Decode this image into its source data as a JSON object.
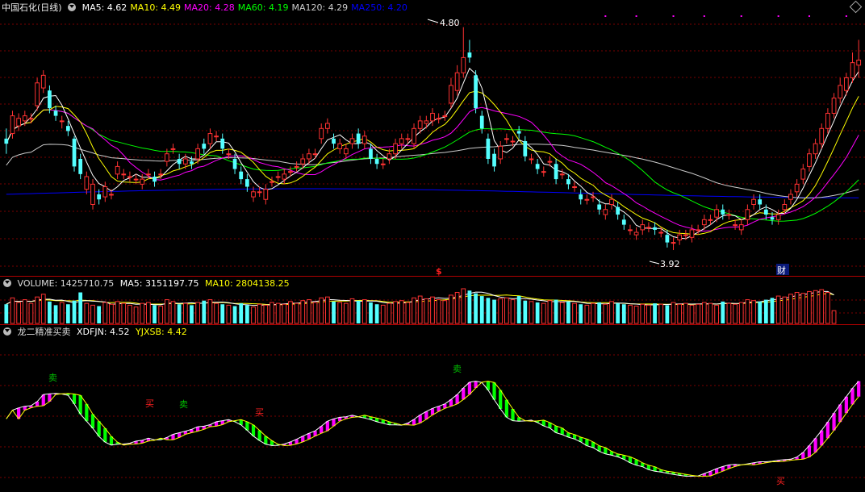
{
  "main_header": {
    "title": "中国石化(日线)",
    "indicators": [
      {
        "label": "MA5: 4.62",
        "color": "#ffffff"
      },
      {
        "label": "MA10: 4.49",
        "color": "#ffff00"
      },
      {
        "label": "MA20: 4.28",
        "color": "#ff00ff"
      },
      {
        "label": "MA60: 4.19",
        "color": "#00ff00"
      },
      {
        "label": "MA120: 4.29",
        "color": "#cccccc"
      },
      {
        "label": "MA250: 4.20",
        "color": "#0000ff"
      }
    ]
  },
  "volume_header": {
    "title": "VOLUME: 1425710.75",
    "ma5": "MA5: 3151197.75",
    "ma10": "MA10: 2804138.25"
  },
  "indicator_header": {
    "title": "龙二精准买卖",
    "xdfjn": "XDFJN: 4.52",
    "yjxsb": "YJXSB: 4.42"
  },
  "annotations": {
    "high_label": "4.80",
    "low_label": "3.92",
    "dollar_marker": "$",
    "finance_marker": "财",
    "buy_label": "买",
    "sell_label": "卖"
  },
  "colors": {
    "up": "#ff3232",
    "down": "#54ffff",
    "grid": "#7a0000",
    "separator": "#b00000",
    "ma5": "#ffffff",
    "ma10": "#ffff00",
    "ma20": "#ff00ff",
    "ma60": "#00ff00",
    "ma120": "#cccccc",
    "ma250": "#0000ff",
    "ind_up": "#ff00ff",
    "ind_down": "#00ff00"
  },
  "chart_data": {
    "type": "candlestick",
    "symbol": "中国石化",
    "period": "日线",
    "price_range": [
      3.85,
      4.85
    ],
    "price_high": 4.8,
    "price_low": 3.92,
    "candles": [
      {
        "o": 4.36,
        "c": 4.34,
        "h": 4.4,
        "l": 4.3
      },
      {
        "o": 4.38,
        "c": 4.45,
        "h": 4.47,
        "l": 4.36
      },
      {
        "o": 4.41,
        "c": 4.44,
        "h": 4.46,
        "l": 4.39
      },
      {
        "o": 4.43,
        "c": 4.45,
        "h": 4.47,
        "l": 4.41
      },
      {
        "o": 4.44,
        "c": 4.44,
        "h": 4.46,
        "l": 4.42
      },
      {
        "o": 4.49,
        "c": 4.58,
        "h": 4.6,
        "l": 4.47
      },
      {
        "o": 4.56,
        "c": 4.61,
        "h": 4.63,
        "l": 4.54
      },
      {
        "o": 4.55,
        "c": 4.48,
        "h": 4.57,
        "l": 4.46
      },
      {
        "o": 4.47,
        "c": 4.45,
        "h": 4.49,
        "l": 4.43
      },
      {
        "o": 4.43,
        "c": 4.43,
        "h": 4.45,
        "l": 4.4
      },
      {
        "o": 4.41,
        "c": 4.39,
        "h": 4.43,
        "l": 4.37
      },
      {
        "o": 4.36,
        "c": 4.25,
        "h": 4.37,
        "l": 4.23
      },
      {
        "o": 4.28,
        "c": 4.22,
        "h": 4.3,
        "l": 4.2
      },
      {
        "o": 4.16,
        "c": 4.21,
        "h": 4.23,
        "l": 4.14
      },
      {
        "o": 4.1,
        "c": 4.18,
        "h": 4.2,
        "l": 4.08
      },
      {
        "o": 4.14,
        "c": 4.12,
        "h": 4.16,
        "l": 4.1
      },
      {
        "o": 4.13,
        "c": 4.17,
        "h": 4.19,
        "l": 4.11
      },
      {
        "o": 4.14,
        "c": 4.14,
        "h": 4.16,
        "l": 4.12
      },
      {
        "o": 4.22,
        "c": 4.25,
        "h": 4.27,
        "l": 4.2
      },
      {
        "o": 4.22,
        "c": 4.22,
        "h": 4.24,
        "l": 4.2
      },
      {
        "o": 4.21,
        "c": 4.21,
        "h": 4.23,
        "l": 4.19
      },
      {
        "o": 4.2,
        "c": 4.2,
        "h": 4.22,
        "l": 4.18
      },
      {
        "o": 4.18,
        "c": 4.2,
        "h": 4.22,
        "l": 4.16
      },
      {
        "o": 4.22,
        "c": 4.22,
        "h": 4.24,
        "l": 4.2
      },
      {
        "o": 4.21,
        "c": 4.19,
        "h": 4.23,
        "l": 4.17
      },
      {
        "o": 4.22,
        "c": 4.22,
        "h": 4.24,
        "l": 4.2
      },
      {
        "o": 4.27,
        "c": 4.3,
        "h": 4.32,
        "l": 4.25
      },
      {
        "o": 4.32,
        "c": 4.32,
        "h": 4.34,
        "l": 4.3
      },
      {
        "o": 4.28,
        "c": 4.26,
        "h": 4.3,
        "l": 4.24
      },
      {
        "o": 4.26,
        "c": 4.28,
        "h": 4.3,
        "l": 4.24
      },
      {
        "o": 4.27,
        "c": 4.26,
        "h": 4.29,
        "l": 4.24
      },
      {
        "o": 4.28,
        "c": 4.32,
        "h": 4.34,
        "l": 4.26
      },
      {
        "o": 4.34,
        "c": 4.32,
        "h": 4.36,
        "l": 4.3
      },
      {
        "o": 4.34,
        "c": 4.38,
        "h": 4.4,
        "l": 4.32
      },
      {
        "o": 4.37,
        "c": 4.37,
        "h": 4.39,
        "l": 4.35
      },
      {
        "o": 4.36,
        "c": 4.32,
        "h": 4.38,
        "l": 4.3
      },
      {
        "o": 4.3,
        "c": 4.3,
        "h": 4.32,
        "l": 4.28
      },
      {
        "o": 4.28,
        "c": 4.24,
        "h": 4.3,
        "l": 4.22
      },
      {
        "o": 4.23,
        "c": 4.2,
        "h": 4.25,
        "l": 4.18
      },
      {
        "o": 4.2,
        "c": 4.17,
        "h": 4.22,
        "l": 4.15
      },
      {
        "o": 4.13,
        "c": 4.15,
        "h": 4.17,
        "l": 4.11
      },
      {
        "o": 4.15,
        "c": 4.15,
        "h": 4.17,
        "l": 4.13
      },
      {
        "o": 4.12,
        "c": 4.16,
        "h": 4.18,
        "l": 4.1
      },
      {
        "o": 4.19,
        "c": 4.19,
        "h": 4.21,
        "l": 4.17
      },
      {
        "o": 4.21,
        "c": 4.21,
        "h": 4.23,
        "l": 4.19
      },
      {
        "o": 4.2,
        "c": 4.22,
        "h": 4.24,
        "l": 4.18
      },
      {
        "o": 4.23,
        "c": 4.23,
        "h": 4.25,
        "l": 4.21
      },
      {
        "o": 4.25,
        "c": 4.25,
        "h": 4.27,
        "l": 4.23
      },
      {
        "o": 4.26,
        "c": 4.28,
        "h": 4.3,
        "l": 4.24
      },
      {
        "o": 4.28,
        "c": 4.3,
        "h": 4.32,
        "l": 4.26
      },
      {
        "o": 4.3,
        "c": 4.3,
        "h": 4.32,
        "l": 4.28
      },
      {
        "o": 4.36,
        "c": 4.4,
        "h": 4.42,
        "l": 4.34
      },
      {
        "o": 4.4,
        "c": 4.42,
        "h": 4.44,
        "l": 4.38
      },
      {
        "o": 4.36,
        "c": 4.34,
        "h": 4.38,
        "l": 4.32
      },
      {
        "o": 4.32,
        "c": 4.34,
        "h": 4.36,
        "l": 4.3
      },
      {
        "o": 4.3,
        "c": 4.32,
        "h": 4.34,
        "l": 4.28
      },
      {
        "o": 4.34,
        "c": 4.36,
        "h": 4.38,
        "l": 4.32
      },
      {
        "o": 4.38,
        "c": 4.34,
        "h": 4.4,
        "l": 4.32
      },
      {
        "o": 4.34,
        "c": 4.37,
        "h": 4.39,
        "l": 4.32
      },
      {
        "o": 4.32,
        "c": 4.28,
        "h": 4.34,
        "l": 4.26
      },
      {
        "o": 4.28,
        "c": 4.26,
        "h": 4.3,
        "l": 4.24
      },
      {
        "o": 4.26,
        "c": 4.26,
        "h": 4.28,
        "l": 4.24
      },
      {
        "o": 4.28,
        "c": 4.3,
        "h": 4.32,
        "l": 4.26
      },
      {
        "o": 4.3,
        "c": 4.34,
        "h": 4.36,
        "l": 4.28
      },
      {
        "o": 4.34,
        "c": 4.36,
        "h": 4.38,
        "l": 4.32
      },
      {
        "o": 4.36,
        "c": 4.36,
        "h": 4.38,
        "l": 4.34
      },
      {
        "o": 4.34,
        "c": 4.4,
        "h": 4.42,
        "l": 4.32
      },
      {
        "o": 4.4,
        "c": 4.43,
        "h": 4.45,
        "l": 4.38
      },
      {
        "o": 4.42,
        "c": 4.43,
        "h": 4.45,
        "l": 4.4
      },
      {
        "o": 4.43,
        "c": 4.46,
        "h": 4.48,
        "l": 4.41
      },
      {
        "o": 4.44,
        "c": 4.44,
        "h": 4.46,
        "l": 4.42
      },
      {
        "o": 4.45,
        "c": 4.45,
        "h": 4.47,
        "l": 4.43
      },
      {
        "o": 4.5,
        "c": 4.57,
        "h": 4.6,
        "l": 4.48
      },
      {
        "o": 4.55,
        "c": 4.62,
        "h": 4.65,
        "l": 4.53
      },
      {
        "o": 4.62,
        "c": 4.68,
        "h": 4.8,
        "l": 4.6
      },
      {
        "o": 4.7,
        "c": 4.68,
        "h": 4.75,
        "l": 4.66
      },
      {
        "o": 4.61,
        "c": 4.48,
        "h": 4.63,
        "l": 4.46
      },
      {
        "o": 4.45,
        "c": 4.4,
        "h": 4.47,
        "l": 4.38
      },
      {
        "o": 4.36,
        "c": 4.28,
        "h": 4.38,
        "l": 4.26
      },
      {
        "o": 4.3,
        "c": 4.25,
        "h": 4.32,
        "l": 4.23
      },
      {
        "o": 4.28,
        "c": 4.33,
        "h": 4.35,
        "l": 4.26
      },
      {
        "o": 4.36,
        "c": 4.36,
        "h": 4.38,
        "l": 4.34
      },
      {
        "o": 4.35,
        "c": 4.35,
        "h": 4.37,
        "l": 4.33
      },
      {
        "o": 4.39,
        "c": 4.38,
        "h": 4.41,
        "l": 4.36
      },
      {
        "o": 4.35,
        "c": 4.29,
        "h": 4.37,
        "l": 4.27
      },
      {
        "o": 4.28,
        "c": 4.28,
        "h": 4.3,
        "l": 4.26
      },
      {
        "o": 4.26,
        "c": 4.24,
        "h": 4.28,
        "l": 4.22
      },
      {
        "o": 4.23,
        "c": 4.23,
        "h": 4.25,
        "l": 4.21
      },
      {
        "o": 4.27,
        "c": 4.27,
        "h": 4.29,
        "l": 4.25
      },
      {
        "o": 4.26,
        "c": 4.2,
        "h": 4.28,
        "l": 4.18
      },
      {
        "o": 4.22,
        "c": 4.22,
        "h": 4.24,
        "l": 4.2
      },
      {
        "o": 4.2,
        "c": 4.18,
        "h": 4.22,
        "l": 4.16
      },
      {
        "o": 4.17,
        "c": 4.17,
        "h": 4.19,
        "l": 4.15
      },
      {
        "o": 4.14,
        "c": 4.12,
        "h": 4.16,
        "l": 4.1
      },
      {
        "o": 4.12,
        "c": 4.12,
        "h": 4.14,
        "l": 4.1
      },
      {
        "o": 4.13,
        "c": 4.13,
        "h": 4.15,
        "l": 4.11
      },
      {
        "o": 4.1,
        "c": 4.08,
        "h": 4.12,
        "l": 4.06
      },
      {
        "o": 4.06,
        "c": 4.08,
        "h": 4.1,
        "l": 4.04
      },
      {
        "o": 4.1,
        "c": 4.12,
        "h": 4.14,
        "l": 4.08
      },
      {
        "o": 4.09,
        "c": 4.06,
        "h": 4.11,
        "l": 4.04
      },
      {
        "o": 4.04,
        "c": 4.02,
        "h": 4.06,
        "l": 4.0
      },
      {
        "o": 4.0,
        "c": 4.0,
        "h": 4.02,
        "l": 3.98
      },
      {
        "o": 3.98,
        "c": 3.99,
        "h": 4.01,
        "l": 3.96
      },
      {
        "o": 4.0,
        "c": 4.02,
        "h": 4.04,
        "l": 3.98
      },
      {
        "o": 4.01,
        "c": 4.01,
        "h": 4.03,
        "l": 3.99
      },
      {
        "o": 4.01,
        "c": 4.0,
        "h": 4.03,
        "l": 3.98
      },
      {
        "o": 3.99,
        "c": 3.99,
        "h": 4.01,
        "l": 3.97
      },
      {
        "o": 3.98,
        "c": 3.95,
        "h": 4.0,
        "l": 3.93
      },
      {
        "o": 3.95,
        "c": 3.95,
        "h": 3.97,
        "l": 3.92
      },
      {
        "o": 3.96,
        "c": 3.98,
        "h": 4.0,
        "l": 3.94
      },
      {
        "o": 3.98,
        "c": 3.98,
        "h": 4.0,
        "l": 3.96
      },
      {
        "o": 3.97,
        "c": 4.0,
        "h": 4.02,
        "l": 3.95
      },
      {
        "o": 4.0,
        "c": 4.0,
        "h": 4.02,
        "l": 3.98
      },
      {
        "o": 4.02,
        "c": 4.04,
        "h": 4.06,
        "l": 4.0
      },
      {
        "o": 4.04,
        "c": 4.04,
        "h": 4.06,
        "l": 4.02
      },
      {
        "o": 4.05,
        "c": 4.08,
        "h": 4.1,
        "l": 4.03
      },
      {
        "o": 4.08,
        "c": 4.06,
        "h": 4.1,
        "l": 4.04
      },
      {
        "o": 4.06,
        "c": 4.06,
        "h": 4.08,
        "l": 4.04
      },
      {
        "o": 4.02,
        "c": 4.02,
        "h": 4.04,
        "l": 4.0
      },
      {
        "o": 4.0,
        "c": 4.02,
        "h": 4.04,
        "l": 3.98
      },
      {
        "o": 4.04,
        "c": 4.08,
        "h": 4.1,
        "l": 4.02
      },
      {
        "o": 4.1,
        "c": 4.12,
        "h": 4.14,
        "l": 4.08
      },
      {
        "o": 4.12,
        "c": 4.1,
        "h": 4.14,
        "l": 4.08
      },
      {
        "o": 4.08,
        "c": 4.06,
        "h": 4.1,
        "l": 4.04
      },
      {
        "o": 4.05,
        "c": 4.04,
        "h": 4.07,
        "l": 4.02
      },
      {
        "o": 4.04,
        "c": 4.06,
        "h": 4.08,
        "l": 4.02
      },
      {
        "o": 4.08,
        "c": 4.1,
        "h": 4.12,
        "l": 4.06
      },
      {
        "o": 4.12,
        "c": 4.14,
        "h": 4.16,
        "l": 4.1
      },
      {
        "o": 4.15,
        "c": 4.18,
        "h": 4.2,
        "l": 4.13
      },
      {
        "o": 4.2,
        "c": 4.24,
        "h": 4.26,
        "l": 4.18
      },
      {
        "o": 4.25,
        "c": 4.3,
        "h": 4.32,
        "l": 4.23
      },
      {
        "o": 4.3,
        "c": 4.34,
        "h": 4.36,
        "l": 4.28
      },
      {
        "o": 4.34,
        "c": 4.4,
        "h": 4.42,
        "l": 4.32
      },
      {
        "o": 4.4,
        "c": 4.46,
        "h": 4.48,
        "l": 4.38
      },
      {
        "o": 4.46,
        "c": 4.52,
        "h": 4.54,
        "l": 4.44
      },
      {
        "o": 4.52,
        "c": 4.57,
        "h": 4.6,
        "l": 4.5
      },
      {
        "o": 4.55,
        "c": 4.6,
        "h": 4.62,
        "l": 4.53
      },
      {
        "o": 4.6,
        "c": 4.66,
        "h": 4.7,
        "l": 4.58
      },
      {
        "o": 4.65,
        "c": 4.67,
        "h": 4.75,
        "l": 4.6
      }
    ],
    "volumes": [
      2.1,
      2.8,
      2.3,
      2.6,
      2.2,
      2.9,
      3.2,
      2.4,
      2.0,
      2.3,
      2.1,
      2.5,
      3.4,
      2.2,
      2.0,
      1.9,
      2.3,
      2.1,
      2.4,
      2.2,
      2.0,
      1.8,
      2.2,
      2.3,
      2.0,
      1.9,
      2.6,
      2.4,
      2.1,
      2.2,
      2.0,
      2.3,
      2.5,
      2.6,
      2.2,
      2.1,
      2.0,
      1.9,
      2.2,
      2.0,
      1.8,
      2.1,
      2.0,
      2.3,
      2.2,
      2.1,
      2.4,
      2.2,
      2.5,
      2.6,
      2.3,
      2.8,
      2.9,
      2.4,
      2.3,
      2.2,
      2.7,
      2.5,
      2.6,
      2.3,
      2.1,
      2.0,
      2.2,
      2.4,
      2.5,
      2.3,
      2.8,
      3.0,
      2.7,
      2.9,
      2.6,
      2.5,
      3.1,
      3.4,
      3.8,
      3.6,
      3.3,
      3.0,
      2.8,
      2.6,
      2.7,
      2.8,
      2.6,
      3.0,
      2.5,
      2.4,
      2.3,
      2.2,
      2.5,
      2.6,
      2.3,
      2.4,
      2.2,
      2.1,
      2.0,
      2.2,
      2.3,
      2.1,
      2.4,
      2.2,
      2.1,
      2.0,
      1.9,
      2.1,
      2.0,
      2.2,
      2.1,
      2.0,
      2.3,
      2.1,
      2.2,
      2.0,
      2.1,
      2.3,
      2.2,
      2.0,
      2.4,
      2.2,
      2.1,
      2.3,
      2.6,
      2.5,
      2.4,
      2.6,
      2.8,
      3.0,
      2.9,
      3.2,
      3.4,
      3.3,
      3.5,
      3.6,
      3.7,
      3.4,
      1.4
    ]
  }
}
